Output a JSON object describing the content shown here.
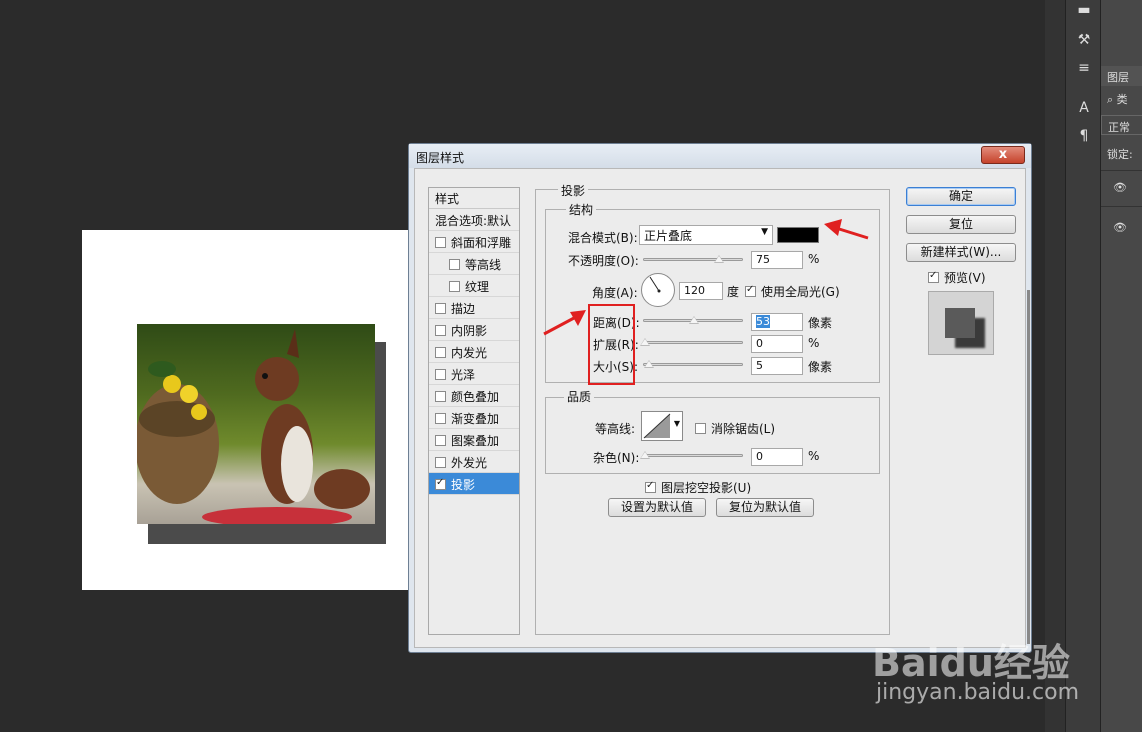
{
  "dialog": {
    "title": "图层样式",
    "close_glyph": "x"
  },
  "style_list": {
    "header": "样式",
    "blend_options": "混合选项:默认",
    "items": [
      {
        "label": "斜面和浮雕",
        "checked": false,
        "sub": false
      },
      {
        "label": "等高线",
        "checked": false,
        "sub": true
      },
      {
        "label": "纹理",
        "checked": false,
        "sub": true
      },
      {
        "label": "描边",
        "checked": false,
        "sub": false
      },
      {
        "label": "内阴影",
        "checked": false,
        "sub": false
      },
      {
        "label": "内发光",
        "checked": false,
        "sub": false
      },
      {
        "label": "光泽",
        "checked": false,
        "sub": false
      },
      {
        "label": "颜色叠加",
        "checked": false,
        "sub": false
      },
      {
        "label": "渐变叠加",
        "checked": false,
        "sub": false
      },
      {
        "label": "图案叠加",
        "checked": false,
        "sub": false
      },
      {
        "label": "外发光",
        "checked": false,
        "sub": false
      },
      {
        "label": "投影",
        "checked": true,
        "sub": false,
        "selected": true
      }
    ]
  },
  "drop_shadow": {
    "section_title": "投影",
    "structure_title": "结构",
    "blend_mode_label": "混合模式(B):",
    "blend_mode_value": "正片叠底",
    "shadow_color": "#000000",
    "opacity_label": "不透明度(O):",
    "opacity_value": "75",
    "opacity_unit": "%",
    "angle_label": "角度(A):",
    "angle_value": "120",
    "angle_unit": "度",
    "global_light_label": "使用全局光(G)",
    "global_light_checked": true,
    "distance_label": "距离(D):",
    "distance_value": "53",
    "distance_unit": "像素",
    "spread_label": "扩展(R):",
    "spread_value": "0",
    "spread_unit": "%",
    "size_label": "大小(S):",
    "size_value": "5",
    "size_unit": "像素",
    "quality_title": "品质",
    "contour_label": "等高线:",
    "antialias_label": "消除锯齿(L)",
    "antialias_checked": false,
    "noise_label": "杂色(N):",
    "noise_value": "0",
    "noise_unit": "%",
    "knockout_label": "图层挖空投影(U)",
    "knockout_checked": true,
    "make_default": "设置为默认值",
    "reset_default": "复位为默认值"
  },
  "buttons": {
    "ok": "确定",
    "reset": "复位",
    "new_style": "新建样式(W)...",
    "preview_label": "预览(V)",
    "preview_checked": true
  },
  "layers_panel": {
    "tab": "图层",
    "search": "类",
    "blend": "正常",
    "lock": "锁定:"
  },
  "watermark": {
    "brand": "Baidu经验",
    "url": "jingyan.baidu.com"
  }
}
